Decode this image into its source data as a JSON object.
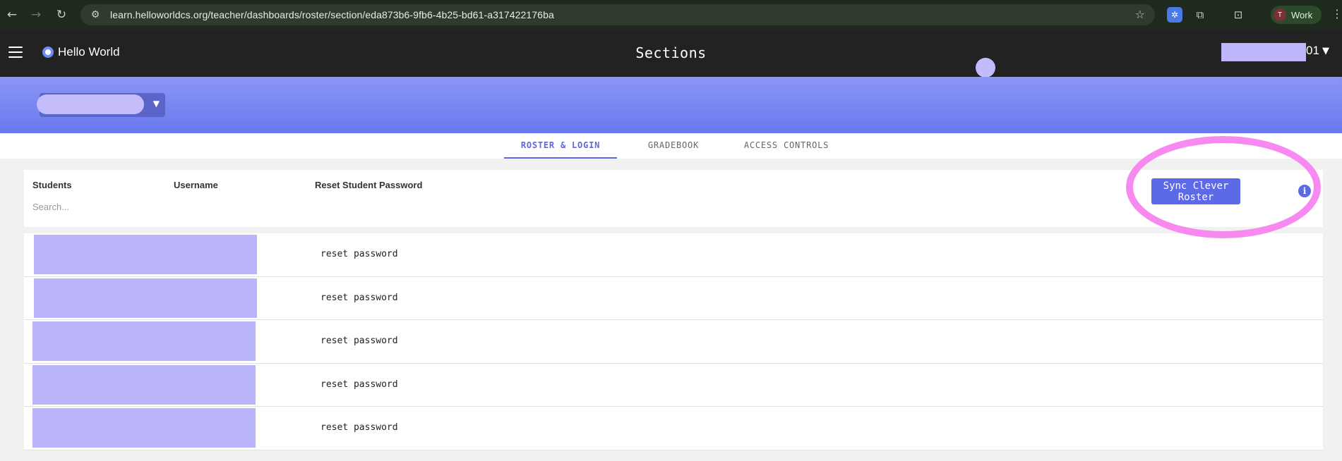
{
  "browser": {
    "url": "learn.helloworldcs.org/teacher/dashboards/roster/section/eda873b6-9fb6-4b25-bd61-a317422176ba",
    "profile_initial": "T",
    "profile_name": "Work"
  },
  "header": {
    "logo_text": "Hello World",
    "title": "Sections",
    "user_suffix": "01"
  },
  "tabs": [
    {
      "label": "ROSTER & LOGIN",
      "active": true
    },
    {
      "label": "GRADEBOOK",
      "active": false
    },
    {
      "label": "ACCESS CONTROLS",
      "active": false
    }
  ],
  "table": {
    "columns": [
      "Students",
      "Username",
      "Reset Student Password"
    ],
    "search_placeholder": "Search...",
    "sync_button": "Sync Clever Roster",
    "info_glyph": "i",
    "rows": [
      {
        "reset": "reset password"
      },
      {
        "reset": "reset password"
      },
      {
        "reset": "reset password"
      },
      {
        "reset": "reset password"
      },
      {
        "reset": "reset password"
      }
    ]
  },
  "colors": {
    "accent": "#5d6ae8",
    "banner": "#7b87f2",
    "annotation": "#f789f0",
    "redaction": "#bab4fb"
  }
}
